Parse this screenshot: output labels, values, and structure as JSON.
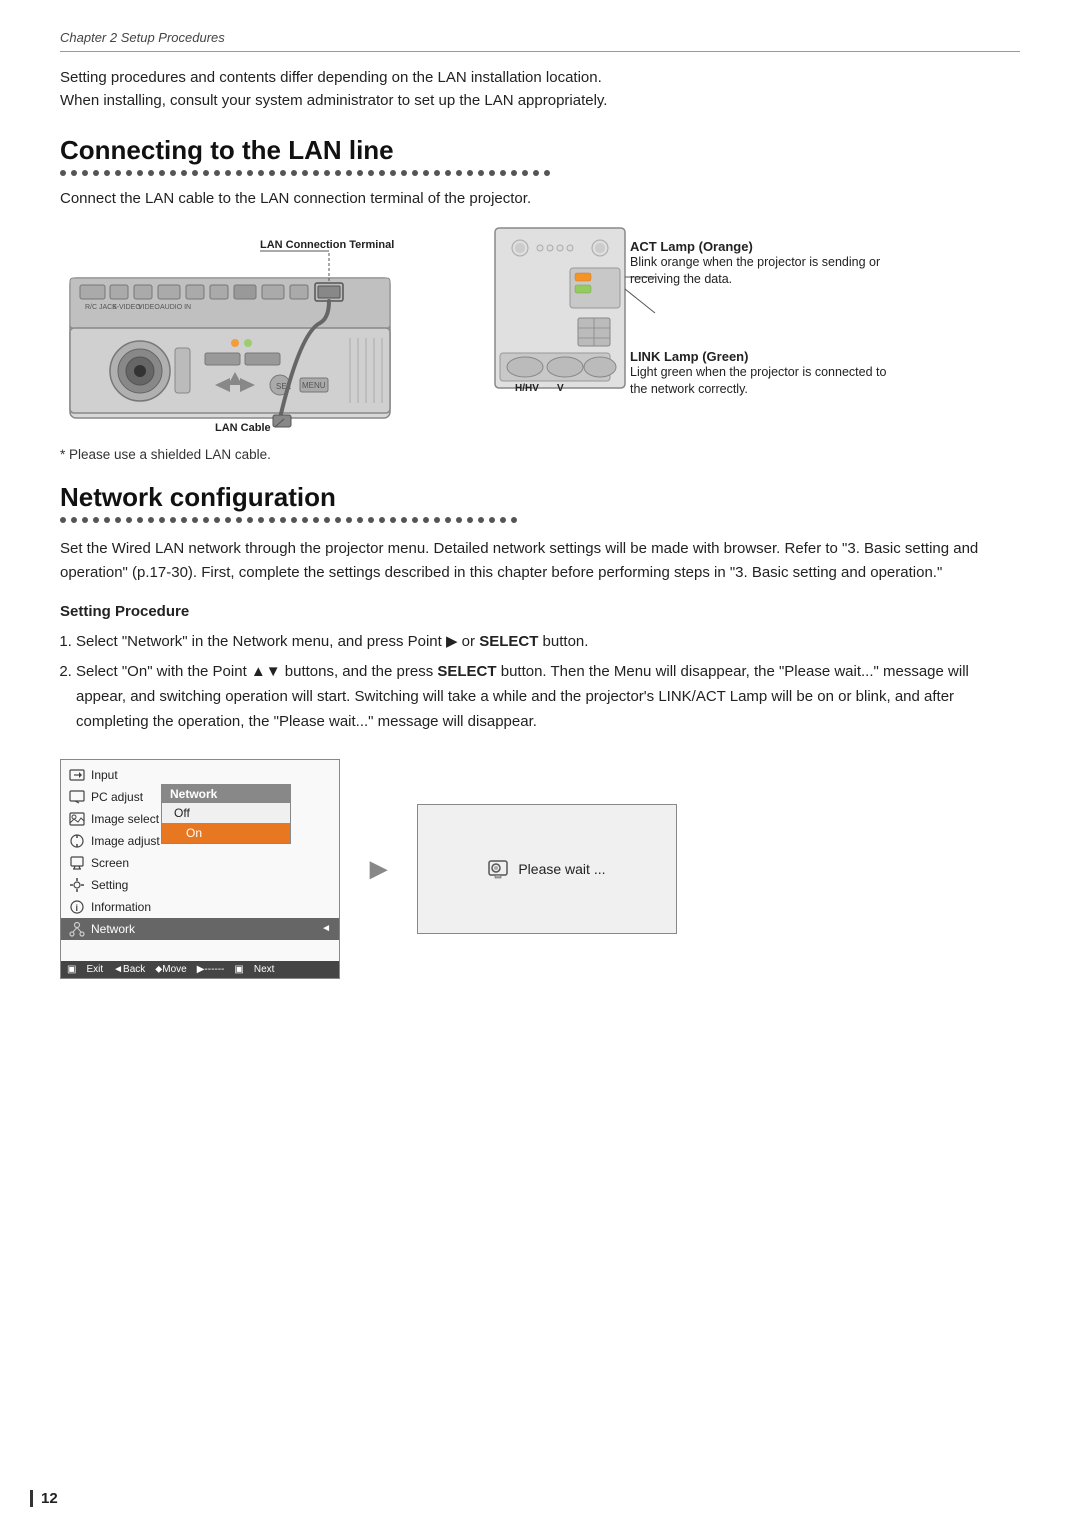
{
  "chapter": {
    "header": "Chapter 2 Setup Procedures"
  },
  "intro": {
    "text": "Setting procedures and contents differ depending on the LAN installation location.\nWhen installing, consult your system administrator to set up the LAN appropriately."
  },
  "section1": {
    "title": "Connecting to the LAN line",
    "intro": "Connect the LAN cable to the LAN connection terminal of the projector.",
    "lan_connection_label": "LAN Connection Terminal",
    "lan_cable_label": "LAN Cable",
    "shielded_note": "* Please use a shielded LAN cable.",
    "act_lamp_title": "ACT Lamp (Orange)",
    "act_lamp_desc": "Blink orange when the projector is sending or receiving the data.",
    "link_lamp_title": "LINK Lamp (Green)",
    "link_lamp_desc": "Light green when the projector is connected to the network correctly.",
    "hv_label": "H/HV",
    "v_label": "V"
  },
  "section2": {
    "title": "Network configuration",
    "body": "Set the Wired LAN network through the projector menu. Detailed network settings will be made with browser. Refer to \"3. Basic setting and operation\" (p.17-30). First, complete the settings described in this chapter before performing steps in \"3. Basic setting and operation.\"",
    "procedure_title": "Setting Procedure",
    "steps": [
      "Select \"Network\" in the Network menu, and press Point ▶ or SELECT button.",
      "Select \"On\" with the Point ▲▼ buttons, and the press SELECT button. Then the Menu will disappear, the \"Please wait...\" message will appear, and switching operation will start. Switching will take a while and the projector's LINK/ACT Lamp will be on or blink, and after completing the operation, the \"Please wait...\" message will disappear."
    ]
  },
  "menu_ui": {
    "items": [
      {
        "label": "Input",
        "icon": "input-icon"
      },
      {
        "label": "PC adjust",
        "icon": "pc-adjust-icon"
      },
      {
        "label": "Image select",
        "icon": "image-select-icon"
      },
      {
        "label": "Image adjust",
        "icon": "image-adjust-icon"
      },
      {
        "label": "Screen",
        "icon": "screen-icon"
      },
      {
        "label": "Setting",
        "icon": "setting-icon"
      },
      {
        "label": "Information",
        "icon": "information-icon"
      },
      {
        "label": "Network",
        "icon": "network-icon",
        "active": true
      }
    ],
    "submenu": {
      "title": "Network",
      "options": [
        {
          "label": "Off",
          "selected": false
        },
        {
          "label": "On",
          "selected": true
        }
      ]
    },
    "bottom_bar": {
      "exit": "Exit",
      "back": "◄Back",
      "move": "⬥Move",
      "dashes": "▶------",
      "next": "Next"
    }
  },
  "please_wait": {
    "text": "Please wait ..."
  },
  "page_number": "12"
}
